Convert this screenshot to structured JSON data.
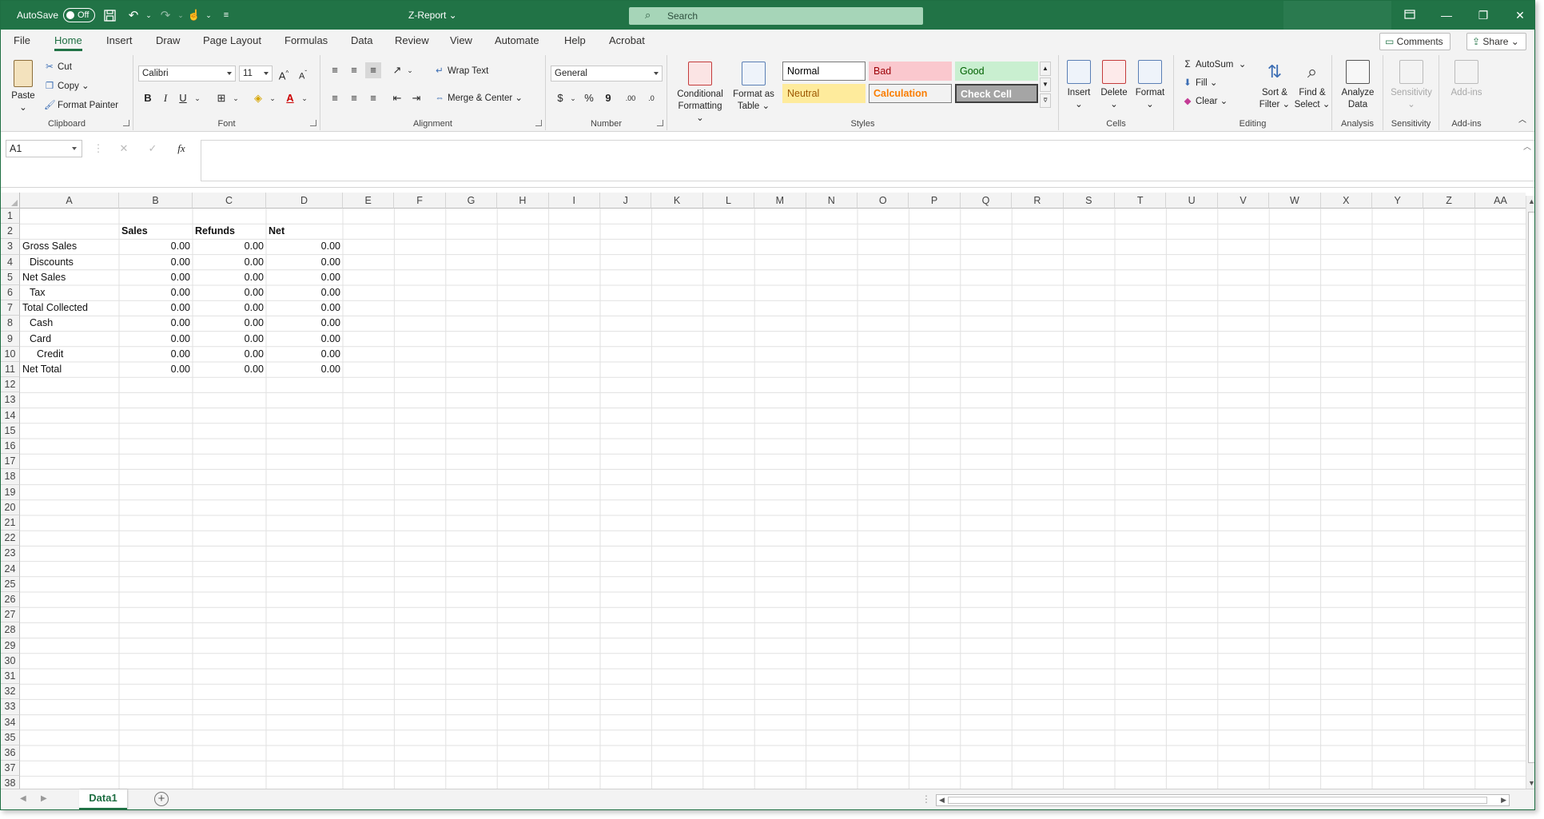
{
  "titlebar": {
    "autosave_label": "AutoSave",
    "autosave_state": "Off",
    "doc_title": "Z-Report",
    "search_placeholder": "Search"
  },
  "menu": {
    "tabs": [
      "File",
      "Home",
      "Insert",
      "Draw",
      "Page Layout",
      "Formulas",
      "Data",
      "Review",
      "View",
      "Automate",
      "Help",
      "Acrobat"
    ],
    "active": "Home",
    "comments_label": "Comments",
    "share_label": "Share"
  },
  "ribbon": {
    "clipboard": {
      "paste": "Paste",
      "cut": "Cut",
      "copy": "Copy",
      "format_painter": "Format Painter",
      "label": "Clipboard"
    },
    "font": {
      "name": "Calibri",
      "size": "11",
      "label": "Font"
    },
    "alignment": {
      "wrap": "Wrap Text",
      "merge": "Merge & Center",
      "label": "Alignment"
    },
    "number": {
      "format": "General",
      "label": "Number"
    },
    "styles": {
      "conditional": "Conditional Formatting",
      "format_table": "Format as Table",
      "normal": "Normal",
      "bad": "Bad",
      "good": "Good",
      "neutral": "Neutral",
      "calculation": "Calculation",
      "check_cell": "Check Cell",
      "label": "Styles"
    },
    "cells": {
      "insert": "Insert",
      "delete": "Delete",
      "format": "Format",
      "label": "Cells"
    },
    "editing": {
      "autosum": "AutoSum",
      "fill": "Fill",
      "clear": "Clear",
      "sort": "Sort & Filter",
      "find": "Find & Select",
      "label": "Editing"
    },
    "analysis": {
      "analyze": "Analyze Data",
      "label": "Analysis"
    },
    "sensitivity": {
      "btn": "Sensitivity",
      "label": "Sensitivity"
    },
    "addins": {
      "btn": "Add-ins",
      "label": "Add-ins"
    }
  },
  "formula_bar": {
    "name_box": "A1",
    "fx": "fx",
    "content": ""
  },
  "columns": [
    "A",
    "B",
    "C",
    "D",
    "E",
    "F",
    "G",
    "H",
    "I",
    "J",
    "K",
    "L",
    "M",
    "N",
    "O",
    "P",
    "Q",
    "R",
    "S",
    "T",
    "U",
    "V",
    "W",
    "X",
    "Y",
    "Z",
    "AA"
  ],
  "rows": [
    "1",
    "2",
    "3",
    "4",
    "5",
    "6",
    "7",
    "8",
    "9",
    "10",
    "11",
    "12",
    "13",
    "14",
    "15",
    "16",
    "17",
    "18",
    "19",
    "20",
    "21",
    "22",
    "23",
    "24",
    "25",
    "26",
    "27",
    "28",
    "29",
    "30",
    "31",
    "32",
    "33",
    "34",
    "35",
    "36",
    "37",
    "38"
  ],
  "sheet": {
    "headers": {
      "b": "Sales",
      "c": "Refunds",
      "d": "Net"
    },
    "rows": [
      {
        "label": "Gross Sales",
        "indent": 0,
        "b": "0.00",
        "c": "0.00",
        "d": "0.00"
      },
      {
        "label": "Discounts",
        "indent": 1,
        "b": "0.00",
        "c": "0.00",
        "d": "0.00"
      },
      {
        "label": "Net Sales",
        "indent": 0,
        "b": "0.00",
        "c": "0.00",
        "d": "0.00"
      },
      {
        "label": "Tax",
        "indent": 1,
        "b": "0.00",
        "c": "0.00",
        "d": "0.00"
      },
      {
        "label": "Total Collected",
        "indent": 0,
        "b": "0.00",
        "c": "0.00",
        "d": "0.00"
      },
      {
        "label": "Cash",
        "indent": 1,
        "b": "0.00",
        "c": "0.00",
        "d": "0.00"
      },
      {
        "label": "Card",
        "indent": 1,
        "b": "0.00",
        "c": "0.00",
        "d": "0.00"
      },
      {
        "label": "Credit",
        "indent": 2,
        "b": "0.00",
        "c": "0.00",
        "d": "0.00"
      },
      {
        "label": "Net Total",
        "indent": 0,
        "b": "0.00",
        "c": "0.00",
        "d": "0.00"
      }
    ]
  },
  "sheet_tabs": [
    "Data1"
  ],
  "colors": {
    "accent": "#217346",
    "search_bg": "#a6d5b8"
  }
}
